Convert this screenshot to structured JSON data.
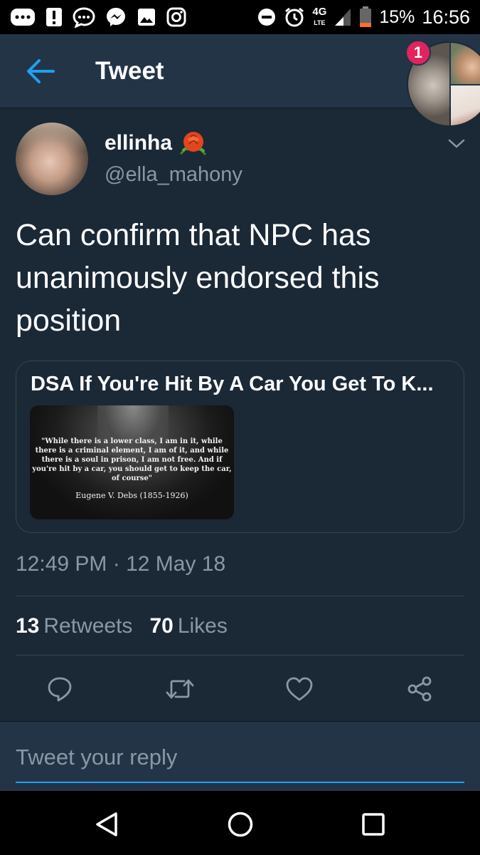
{
  "status_bar": {
    "network": "4G",
    "network_sub": "LTE",
    "battery": "15%",
    "time": "16:56",
    "icons": [
      "more-icon",
      "alert-icon",
      "chat-bubble-icon",
      "messenger-icon",
      "image-icon",
      "instagram-icon",
      "dnd-icon",
      "alarm-icon",
      "signal-icon",
      "battery-icon"
    ]
  },
  "header": {
    "title": "Tweet",
    "notification_count": "1"
  },
  "tweet": {
    "display_name": "ellinha",
    "emoji": "rose",
    "handle": "@ella_mahony",
    "text": "Can confirm that NPC has unanimously endorsed this position",
    "card": {
      "title": "DSA If You're Hit By A Car You Get To K...",
      "quote": "\"While there is a lower class, I am in it, while there is a criminal element, I am of it, and while there is a soul in prison, I am not free. And if you're hit by a car, you should get to keep the car, of course\"",
      "attribution": "Eugene V. Debs (1855-1926)"
    },
    "timestamp": "12:49 PM · 12 May 18",
    "retweets_count": "13",
    "retweets_label": "Retweets",
    "likes_count": "70",
    "likes_label": "Likes"
  },
  "reply": {
    "placeholder": "Tweet your reply"
  },
  "colors": {
    "background": "#1b2836",
    "header": "#243447",
    "accent": "#1da1f2",
    "muted": "#8899a6",
    "badge": "#e0245e"
  }
}
